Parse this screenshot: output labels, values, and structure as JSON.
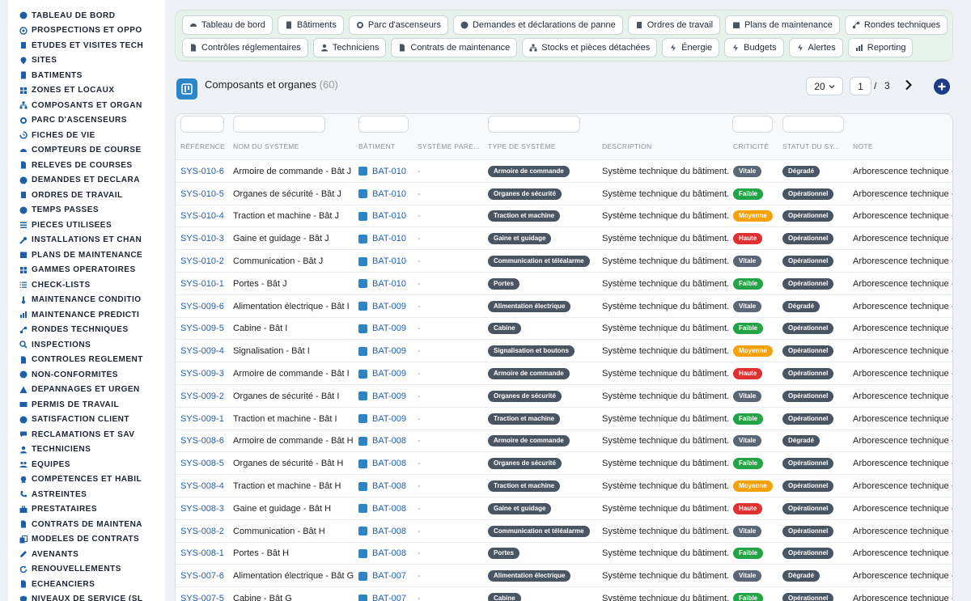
{
  "sidebar": {
    "items": [
      {
        "label": "TABLEAU DE BORD",
        "icon": "dashboard-icon"
      },
      {
        "label": "PROSPECTIONS ET OPPO",
        "icon": "target-icon"
      },
      {
        "label": "ÉTUDES ET VISITES TECH",
        "icon": "clipboard-icon"
      },
      {
        "label": "SITES",
        "icon": "map-pin-icon"
      },
      {
        "label": "BÂTIMENTS",
        "icon": "building-icon"
      },
      {
        "label": "ZONES ET LOCAUX",
        "icon": "grid-icon"
      },
      {
        "label": "COMPOSANTS ET ORGAN",
        "icon": "sitemap-icon"
      },
      {
        "label": "PARC D'ASCENSEURS",
        "icon": "cogs-icon"
      },
      {
        "label": "FICHES DE VIE",
        "icon": "history-icon"
      },
      {
        "label": "COMPTEURS DE COURSE",
        "icon": "gauge-icon"
      },
      {
        "label": "RELEVÉS DE COURSES",
        "icon": "file-icon"
      },
      {
        "label": "DEMANDES ET DÉCLARA",
        "icon": "question-icon"
      },
      {
        "label": "ORDRES DE TRAVAIL",
        "icon": "clipboard-list-icon"
      },
      {
        "label": "TEMPS PASSÉS",
        "icon": "clock-icon"
      },
      {
        "label": "PIÈCES UTILISÉES",
        "icon": "list-icon"
      },
      {
        "label": "INSTALLATIONS ET CHAN",
        "icon": "wrench-icon"
      },
      {
        "label": "PLANS DE MAINTENANCE",
        "icon": "calendar-icon"
      },
      {
        "label": "GAMMES OPÉRATOIRES",
        "icon": "grid-icon"
      },
      {
        "label": "CHECK-LISTS",
        "icon": "checklist-icon"
      },
      {
        "label": "MAINTENANCE CONDITIO",
        "icon": "thermometer-icon"
      },
      {
        "label": "MAINTENANCE PRÉDICTI",
        "icon": "chart-icon"
      },
      {
        "label": "RONDES TECHNIQUES",
        "icon": "route-icon"
      },
      {
        "label": "INSPECTIONS",
        "icon": "search-icon"
      },
      {
        "label": "CONTRÔLES RÉGLEMENT",
        "icon": "file-check-icon"
      },
      {
        "label": "NON-CONFORMITÉS",
        "icon": "alert-circle-icon"
      },
      {
        "label": "DÉPANNAGES ET URGEN",
        "icon": "warning-icon"
      },
      {
        "label": "PERMIS DE TRAVAIL",
        "icon": "id-card-icon"
      },
      {
        "label": "SATISFACTION CLIENT",
        "icon": "smile-icon"
      },
      {
        "label": "RÉCLAMATIONS ET SAV",
        "icon": "comments-icon"
      },
      {
        "label": "TECHNICIENS",
        "icon": "user-icon"
      },
      {
        "label": "ÉQUIPES",
        "icon": "users-icon"
      },
      {
        "label": "COMPÉTENCES ET HABIL",
        "icon": "certificate-icon"
      },
      {
        "label": "ASTREINTES",
        "icon": "phone-icon"
      },
      {
        "label": "PRESTATAIRES",
        "icon": "briefcase-icon"
      },
      {
        "label": "CONTRATS DE MAINTENA",
        "icon": "file-contract-icon"
      },
      {
        "label": "MODÈLES DE CONTRATS",
        "icon": "copy-icon"
      },
      {
        "label": "AVENANTS",
        "icon": "edit-icon"
      },
      {
        "label": "RENOUVELLEMENTS",
        "icon": "refresh-icon"
      },
      {
        "label": "ÉCHÉANCIERS",
        "icon": "file-invoice-icon"
      },
      {
        "label": "NIVEAUX DE SERVICE (SL",
        "icon": "shield-icon"
      }
    ]
  },
  "topnav": {
    "row1": [
      "Tableau de bord",
      "Bâtiments",
      "Parc d'ascenseurs",
      "Demandes et déclarations de panne",
      "Ordres de travail",
      "Plans de maintenance",
      "Rondes techniques"
    ],
    "row2": [
      "Contrôles réglementaires",
      "Techniciens",
      "Contrats de maintenance",
      "Stocks et pièces détachées",
      "Énergie",
      "Budgets",
      "Alertes",
      "Reporting"
    ]
  },
  "header": {
    "title": "Composants et organes",
    "count": "(60)"
  },
  "pagination": {
    "page_size": "20",
    "current": "1",
    "separator": "/",
    "total": "3"
  },
  "table": {
    "columns": [
      "RÉFÉRENCE",
      "NOM DU SYSTÈME",
      "BÂTIMENT",
      "SYSTÈME PARE...",
      "TYPE DE SYSTÈME",
      "DESCRIPTION",
      "CRITICITÉ",
      "STATUT DU SY...",
      "NOTE"
    ],
    "rows": [
      {
        "ref": "SYS-010-6",
        "name": "Armoire de commande - Bât J",
        "bat": "BAT-010",
        "parent": "-",
        "type": "Armoire de commande",
        "desc": "Système technique du bâtiment.",
        "crit": "Vitale",
        "status": "Dégradé",
        "note": "Arborescence technique -"
      },
      {
        "ref": "SYS-010-5",
        "name": "Organes de sécurité - Bât J",
        "bat": "BAT-010",
        "parent": "-",
        "type": "Organes de sécurité",
        "desc": "Système technique du bâtiment.",
        "crit": "Faible",
        "status": "Opérationnel",
        "note": "Arborescence technique -"
      },
      {
        "ref": "SYS-010-4",
        "name": "Traction et machine - Bât J",
        "bat": "BAT-010",
        "parent": "-",
        "type": "Traction et machine",
        "desc": "Système technique du bâtiment.",
        "crit": "Moyenne",
        "status": "Opérationnel",
        "note": "Arborescence technique -"
      },
      {
        "ref": "SYS-010-3",
        "name": "Gaine et guidage - Bât J",
        "bat": "BAT-010",
        "parent": "-",
        "type": "Gaine et guidage",
        "desc": "Système technique du bâtiment.",
        "crit": "Haute",
        "status": "Opérationnel",
        "note": "Arborescence technique -"
      },
      {
        "ref": "SYS-010-2",
        "name": "Communication - Bât J",
        "bat": "BAT-010",
        "parent": "-",
        "type": "Communication et téléalarme",
        "desc": "Système technique du bâtiment.",
        "crit": "Vitale",
        "status": "Opérationnel",
        "note": "Arborescence technique -"
      },
      {
        "ref": "SYS-010-1",
        "name": "Portes - Bât J",
        "bat": "BAT-010",
        "parent": "-",
        "type": "Portes",
        "desc": "Système technique du bâtiment.",
        "crit": "Faible",
        "status": "Opérationnel",
        "note": "Arborescence technique -"
      },
      {
        "ref": "SYS-009-6",
        "name": "Alimentation électrique - Bât I",
        "bat": "BAT-009",
        "parent": "-",
        "type": "Alimentation électrique",
        "desc": "Système technique du bâtiment.",
        "crit": "Vitale",
        "status": "Dégradé",
        "note": "Arborescence technique -"
      },
      {
        "ref": "SYS-009-5",
        "name": "Cabine - Bât I",
        "bat": "BAT-009",
        "parent": "-",
        "type": "Cabine",
        "desc": "Système technique du bâtiment.",
        "crit": "Faible",
        "status": "Opérationnel",
        "note": "Arborescence technique -"
      },
      {
        "ref": "SYS-009-4",
        "name": "Signalisation - Bât I",
        "bat": "BAT-009",
        "parent": "-",
        "type": "Signalisation et boutons",
        "desc": "Système technique du bâtiment.",
        "crit": "Moyenne",
        "status": "Opérationnel",
        "note": "Arborescence technique -"
      },
      {
        "ref": "SYS-009-3",
        "name": "Armoire de commande - Bât I",
        "bat": "BAT-009",
        "parent": "-",
        "type": "Armoire de commande",
        "desc": "Système technique du bâtiment.",
        "crit": "Haute",
        "status": "Opérationnel",
        "note": "Arborescence technique -"
      },
      {
        "ref": "SYS-009-2",
        "name": "Organes de sécurité - Bât I",
        "bat": "BAT-009",
        "parent": "-",
        "type": "Organes de sécurité",
        "desc": "Système technique du bâtiment.",
        "crit": "Vitale",
        "status": "Opérationnel",
        "note": "Arborescence technique -"
      },
      {
        "ref": "SYS-009-1",
        "name": "Traction et machine - Bât I",
        "bat": "BAT-009",
        "parent": "-",
        "type": "Traction et machine",
        "desc": "Système technique du bâtiment.",
        "crit": "Faible",
        "status": "Opérationnel",
        "note": "Arborescence technique -"
      },
      {
        "ref": "SYS-008-6",
        "name": "Armoire de commande - Bât H",
        "bat": "BAT-008",
        "parent": "-",
        "type": "Armoire de commande",
        "desc": "Système technique du bâtiment.",
        "crit": "Vitale",
        "status": "Dégradé",
        "note": "Arborescence technique -"
      },
      {
        "ref": "SYS-008-5",
        "name": "Organes de sécurité - Bât H",
        "bat": "BAT-008",
        "parent": "-",
        "type": "Organes de sécurité",
        "desc": "Système technique du bâtiment.",
        "crit": "Faible",
        "status": "Opérationnel",
        "note": "Arborescence technique -"
      },
      {
        "ref": "SYS-008-4",
        "name": "Traction et machine - Bât H",
        "bat": "BAT-008",
        "parent": "-",
        "type": "Traction et machine",
        "desc": "Système technique du bâtiment.",
        "crit": "Moyenne",
        "status": "Opérationnel",
        "note": "Arborescence technique -"
      },
      {
        "ref": "SYS-008-3",
        "name": "Gaine et guidage - Bât H",
        "bat": "BAT-008",
        "parent": "-",
        "type": "Gaine et guidage",
        "desc": "Système technique du bâtiment.",
        "crit": "Haute",
        "status": "Opérationnel",
        "note": "Arborescence technique -"
      },
      {
        "ref": "SYS-008-2",
        "name": "Communication - Bât H",
        "bat": "BAT-008",
        "parent": "-",
        "type": "Communication et téléalarme",
        "desc": "Système technique du bâtiment.",
        "crit": "Vitale",
        "status": "Opérationnel",
        "note": "Arborescence technique -"
      },
      {
        "ref": "SYS-008-1",
        "name": "Portes - Bât H",
        "bat": "BAT-008",
        "parent": "-",
        "type": "Portes",
        "desc": "Système technique du bâtiment.",
        "crit": "Faible",
        "status": "Opérationnel",
        "note": "Arborescence technique -"
      },
      {
        "ref": "SYS-007-6",
        "name": "Alimentation électrique - Bât G",
        "bat": "BAT-007",
        "parent": "-",
        "type": "Alimentation électrique",
        "desc": "Système technique du bâtiment.",
        "crit": "Vitale",
        "status": "Dégradé",
        "note": "Arborescence technique -"
      },
      {
        "ref": "SYS-007-5",
        "name": "Cabine - Bât G",
        "bat": "BAT-007",
        "parent": "-",
        "type": "Cabine",
        "desc": "Système technique du bâtiment.",
        "crit": "Faible",
        "status": "Opérationnel",
        "note": "Arborescence technique -"
      }
    ]
  },
  "colors": {
    "criticite": {
      "Vitale": "#5b6776",
      "Faible": "#22a447",
      "Moyenne": "#f5a10a",
      "Haute": "#e0302f"
    },
    "status": {
      "Dégradé": "#4a5563",
      "Opérationnel": "#4a5563"
    },
    "type": "#4a5563",
    "link": "#1f5fae",
    "accent": "#1f3c8a"
  }
}
